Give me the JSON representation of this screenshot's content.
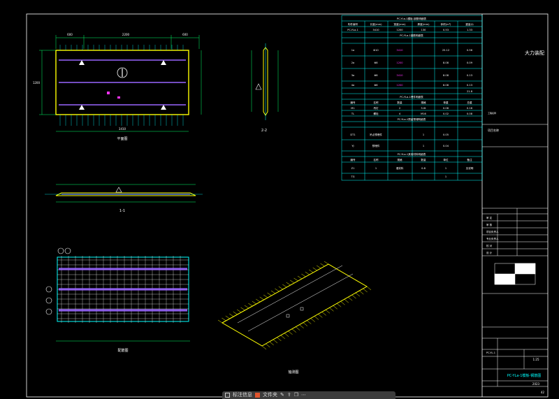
{
  "colors": {
    "frame": "#ffffff",
    "cyan": "#00ffff",
    "yellow": "#ffff00",
    "purple": "#9966ff",
    "green": "#00ff66",
    "magenta": "#ff33ff",
    "grid": "#ffffff"
  },
  "titleblock": {
    "company": "大力装配",
    "field1": "项目名称",
    "field2": "工程名称",
    "dwg_no": "PC-YL-1",
    "scale": "1:25",
    "year": "2023",
    "sheet_label": "PC-YLa-1模板-钢筋图",
    "page_no": "42",
    "rows": [
      "审 定",
      "审 核",
      "项目负责人",
      "专业负责人",
      "校 对",
      "设 计"
    ]
  },
  "views": {
    "plan_title": "平面图",
    "section1_title": "1-1",
    "section2_title": "2-2",
    "rebar_title": "配筋图",
    "iso_title": "轴测图",
    "dims_top": [
      "600",
      "2200",
      "600"
    ],
    "dim_total": "3410",
    "dim_left": "1200"
  },
  "table1": {
    "title": "PC-YLa-1模板-钢筋明细表",
    "headers": [
      "构件编号",
      "长度(mm)",
      "宽度(mm)",
      "厚度(mm)",
      "体积(m³)",
      "重量(t)"
    ],
    "row": [
      "PC-YLa-1",
      "3410",
      "1200",
      "130",
      "0.53",
      "1.33"
    ]
  },
  "table2": {
    "title": "PC-YLa-1钢筋明细表",
    "rows": [
      [
        "1a",
        "Φ10",
        "3410",
        "25.12",
        "0.56"
      ],
      [
        "2a",
        "Φ8",
        "1200",
        "8.08",
        "0.09"
      ],
      [
        "3a",
        "Φ8",
        "3410",
        "8.08",
        "0.13"
      ],
      [
        "4a",
        "Φ8",
        "1200",
        "8.08",
        "0.13"
      ]
    ],
    "total": "21.8"
  },
  "table3": {
    "title": "PC-YLa-1埋件明细表",
    "headers": [
      "编号",
      "名称",
      "数量",
      "规格",
      "单重",
      "总重"
    ],
    "rows": [
      [
        "M1",
        "吊钉",
        "2",
        "5.0t",
        "0.08",
        "0.16"
      ],
      [
        "TL",
        "螺栓",
        "4",
        "M16",
        "0.02",
        "0.08"
      ]
    ]
  },
  "table4": {
    "title": "PC-YLa-1预留预埋明细表",
    "rows": [
      [
        "DT1",
        "吊点预埋件",
        "1",
        "0.05"
      ],
      [
        "YJ",
        "预埋件",
        "1",
        "0.04"
      ]
    ]
  },
  "table5": {
    "title": "PC-YLa-1其他材料明细表",
    "headers": [
      "编号",
      "名称",
      "规格",
      "数量",
      "单位",
      "备注"
    ],
    "rows": [
      [
        "Z1",
        "1",
        "灌浆料",
        "0.8",
        "1",
        "见说明"
      ],
      [
        "TG",
        "",
        "",
        "",
        "1",
        ""
      ]
    ]
  },
  "toolbar": {
    "label1": "标注信息",
    "label2": "文件夹"
  }
}
